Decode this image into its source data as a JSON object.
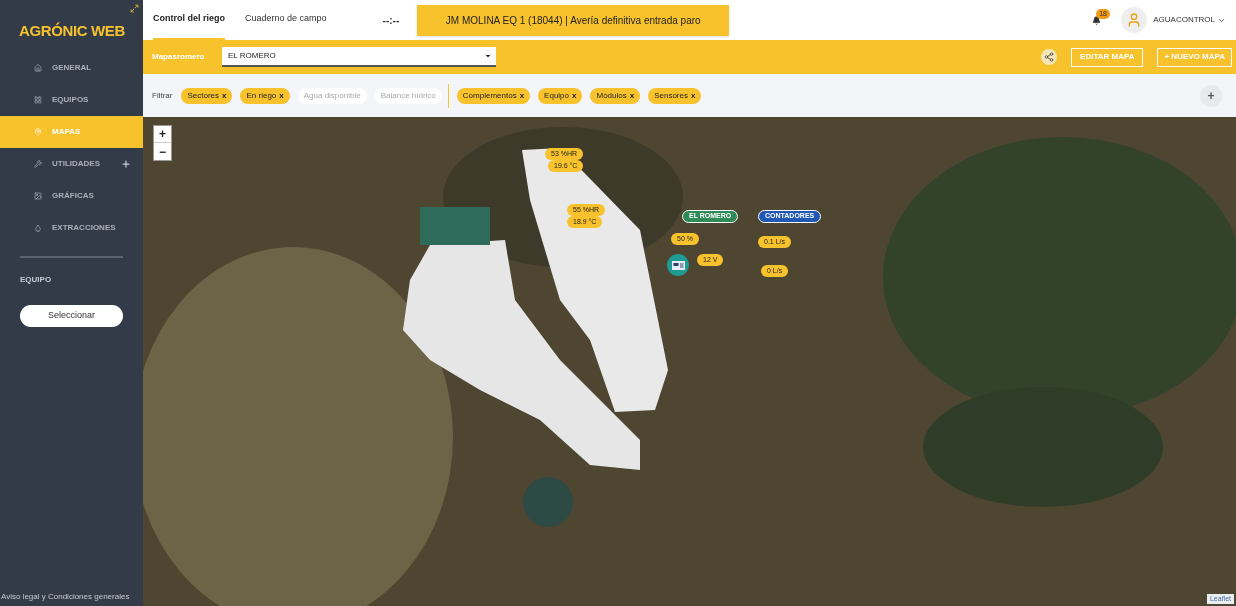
{
  "sidebar": {
    "logo": "AGRÓNIC WEB",
    "items": [
      {
        "label": "GENERAL",
        "selected": false,
        "expandable": false
      },
      {
        "label": "EQUIPOS",
        "selected": false,
        "expandable": false
      },
      {
        "label": "MAPAS",
        "selected": true,
        "expandable": false
      },
      {
        "label": "UTILIDADES",
        "selected": false,
        "expandable": true
      },
      {
        "label": "GRÁFICAS",
        "selected": false,
        "expandable": false
      },
      {
        "label": "EXTRACCIONES",
        "selected": false,
        "expandable": false
      }
    ],
    "section_label": "EQUIPO",
    "select_button": "Seleccionar",
    "footer_link": "Aviso legal y Condiciones generales"
  },
  "topbar": {
    "tabs": [
      {
        "label": "Control del riego",
        "selected": true
      },
      {
        "label": "Cuaderno de campo",
        "selected": false
      }
    ],
    "time": "--:--",
    "alert": "JM MOLINA EQ 1 (18044) | Avería definitiva entrada paro",
    "notifications": "18",
    "user": "AGUACONTROL"
  },
  "map_bar": {
    "label": "Mapasromero",
    "map_select": "EL ROMERO",
    "edit_button": "EDITAR MAPA",
    "new_button": "+ NUEVO MAPA"
  },
  "filters": {
    "label": "Filtrar",
    "groups": [
      [
        {
          "label": "Sectores",
          "selected": true,
          "remove": "x"
        },
        {
          "label": "En riego",
          "selected": true,
          "remove": "x"
        },
        {
          "label": "Agua disponible",
          "selected": false
        },
        {
          "label": "Balance hídrico",
          "selected": false
        }
      ],
      [
        {
          "label": "Complementos",
          "selected": true,
          "remove": "x"
        },
        {
          "label": "Equipo",
          "selected": true,
          "remove": "x"
        },
        {
          "label": "Módulos",
          "selected": true,
          "remove": "x"
        },
        {
          "label": "Sensores",
          "selected": true,
          "remove": "x"
        }
      ]
    ],
    "add_button": "+"
  },
  "map": {
    "zoom_in": "+",
    "zoom_out": "−",
    "attribution": "Leaflet",
    "markers": [
      {
        "text": "53 %HR",
        "kind": "value"
      },
      {
        "text": "19.6 °C",
        "kind": "value"
      },
      {
        "text": "55 %HR",
        "kind": "value"
      },
      {
        "text": "18.9 °C",
        "kind": "value"
      },
      {
        "text": "EL ROMERO",
        "kind": "label",
        "color": "#2e8b57"
      },
      {
        "text": "CONTADORES",
        "kind": "label",
        "color": "#1f57b5"
      },
      {
        "text": "50 %",
        "kind": "value"
      },
      {
        "text": "12 V",
        "kind": "value"
      },
      {
        "text": "0.1 L/s",
        "kind": "value"
      },
      {
        "text": "0 L/s",
        "kind": "value"
      }
    ]
  }
}
